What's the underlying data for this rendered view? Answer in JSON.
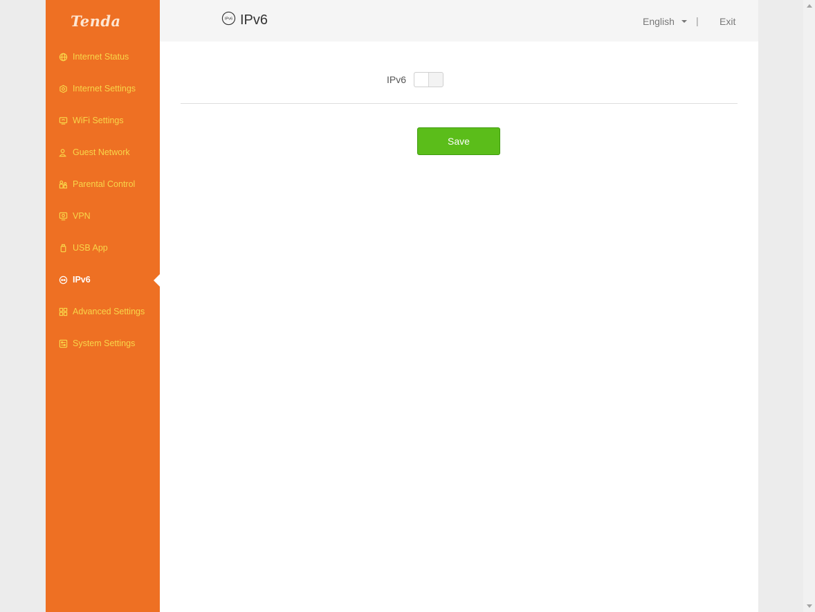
{
  "brand": {
    "logo_text": "Tenda"
  },
  "sidebar": {
    "items": [
      {
        "label": "Internet Status",
        "icon": "globe-icon",
        "active": false
      },
      {
        "label": "Internet Settings",
        "icon": "gear-icon",
        "active": false
      },
      {
        "label": "WiFi Settings",
        "icon": "wifi-icon",
        "active": false
      },
      {
        "label": "Guest Network",
        "icon": "guest-icon",
        "active": false
      },
      {
        "label": "Parental Control",
        "icon": "parental-icon",
        "active": false
      },
      {
        "label": "VPN",
        "icon": "vpn-icon",
        "active": false
      },
      {
        "label": "USB App",
        "icon": "usb-icon",
        "active": false
      },
      {
        "label": "IPv6",
        "icon": "ipv6-icon",
        "active": true
      },
      {
        "label": "Advanced Settings",
        "icon": "grid-icon",
        "active": false
      },
      {
        "label": "System Settings",
        "icon": "system-icon",
        "active": false
      }
    ]
  },
  "header": {
    "title": "IPv6",
    "title_icon_text": "IPv6",
    "language": "English",
    "separator": "|",
    "exit_label": "Exit"
  },
  "form": {
    "ipv6_label": "IPv6",
    "ipv6_enabled": false,
    "save_label": "Save"
  },
  "colors": {
    "sidebar_bg": "#ee7023",
    "sidebar_text": "#f8d64a",
    "save_button": "#5bbd1a"
  }
}
